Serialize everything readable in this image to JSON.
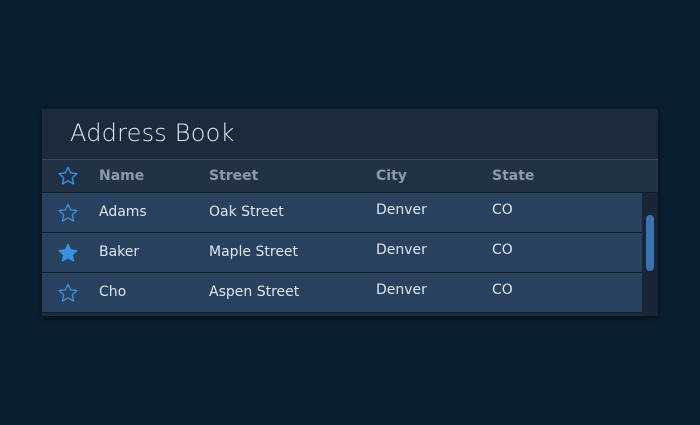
{
  "panel": {
    "title": "Address Book"
  },
  "table": {
    "columns": {
      "favorite": "star-outline-icon",
      "name": "Name",
      "street": "Street",
      "city": "City",
      "state": "State"
    },
    "rows": [
      {
        "favorite": false,
        "name": "Adams",
        "street": "Oak Street",
        "city": "Denver",
        "state": "CO"
      },
      {
        "favorite": true,
        "name": "Baker",
        "street": "Maple Street",
        "city": "Denver",
        "state": "CO"
      },
      {
        "favorite": false,
        "name": "Cho",
        "street": "Aspen Street",
        "city": "Denver",
        "state": "CO"
      }
    ]
  },
  "colors": {
    "accent": "#3a8fe0",
    "page_background": "#0b1f33",
    "row_background": "#27415e"
  }
}
